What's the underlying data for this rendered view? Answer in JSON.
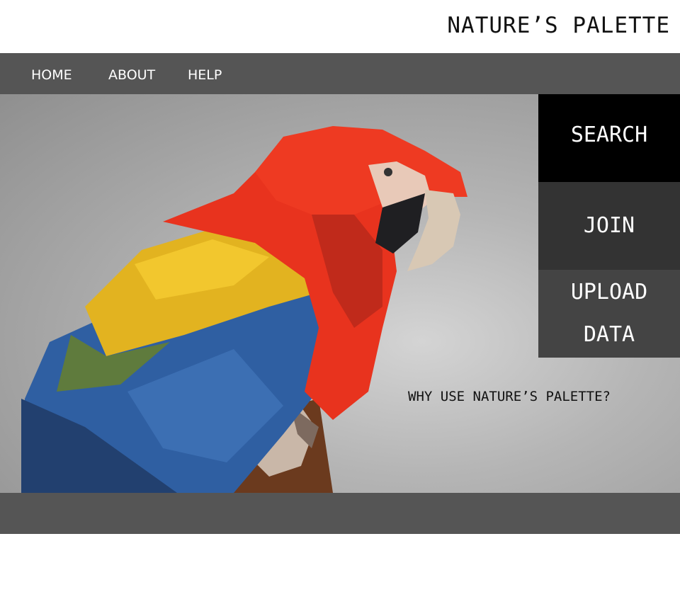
{
  "site": {
    "title": "NATURE’S PALETTE"
  },
  "nav": {
    "items": [
      "HOME",
      "ABOUT",
      "HELP"
    ]
  },
  "actions": {
    "search": "SEARCH",
    "join": "JOIN",
    "upload_line1": "UPLOAD",
    "upload_line2": "DATA"
  },
  "hero": {
    "tagline": "WHY USE NATURE’S PALETTE?",
    "image_subject": "parrot-illustration"
  },
  "colors": {
    "nav_bg": "#555555",
    "search_bg": "#000000",
    "join_bg": "#333333",
    "upload_bg": "#444444"
  }
}
